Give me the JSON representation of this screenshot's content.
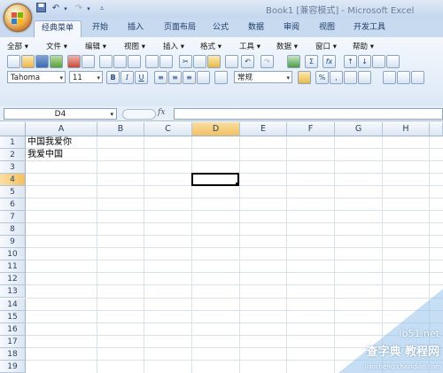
{
  "window": {
    "title": "Book1  [兼容模式] - Microsoft Excel"
  },
  "tabs": [
    "经典菜单",
    "开始",
    "插入",
    "页面布局",
    "公式",
    "数据",
    "审阅",
    "视图",
    "开发工具"
  ],
  "active_tab": "经典菜单",
  "menus": [
    "全部",
    "文件",
    "编辑",
    "视图",
    "插入",
    "格式",
    "工具",
    "数据",
    "窗口",
    "帮助"
  ],
  "font": {
    "name": "Tahoma",
    "size": "11",
    "bold": "B",
    "italic": "I",
    "underline": "U",
    "number_format": "常规"
  },
  "toolbar_symbols": {
    "percent": "%",
    "comma": ",",
    "sigma": "Σ",
    "fx": "fx"
  },
  "name_box": "D4",
  "formula_fx": "fx",
  "columns": [
    "A",
    "B",
    "C",
    "D",
    "E",
    "F",
    "G",
    "H"
  ],
  "active_column": "D",
  "rows": [
    "1",
    "2",
    "3",
    "4",
    "5",
    "6",
    "7",
    "8",
    "9",
    "10",
    "11",
    "12",
    "13",
    "14",
    "15",
    "16",
    "17",
    "18",
    "19"
  ],
  "active_row": "4",
  "cells": {
    "A1": "中国我爱你",
    "A2": "我爱中国"
  },
  "watermark": {
    "line1": "ib51.net",
    "line2": "查字典 教程网",
    "line3": "jiaocheng.chazidian.com"
  }
}
